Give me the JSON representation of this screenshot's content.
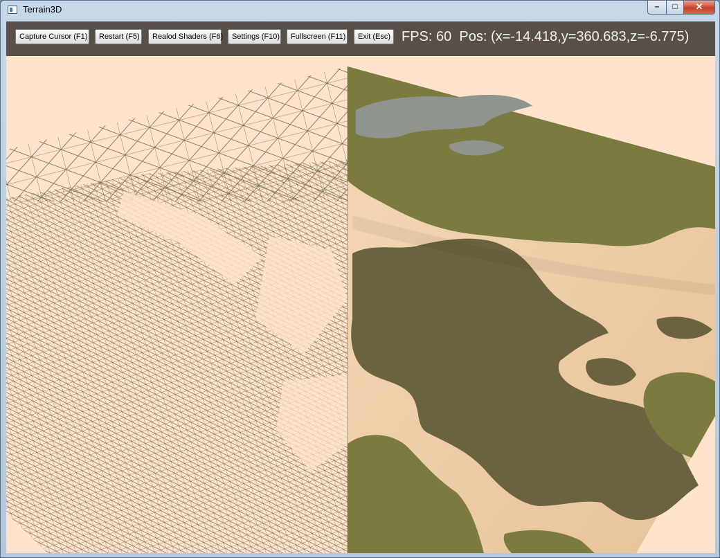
{
  "window": {
    "title": "Terrain3D",
    "controls": {
      "minimize": "–",
      "maximize": "□",
      "close": "✕"
    }
  },
  "toolbar": {
    "buttons": [
      "Capture Cursor (F1)",
      "Restart (F5)",
      "Realod Shaders (F6)",
      "Settings (F10)",
      "Fullscreen (F11)",
      "Exit (Esc)"
    ],
    "fps": "FPS: 60",
    "pos": "Pos: (x=-14.418,y=360.683,z=-6.775)"
  },
  "colors": {
    "background": "#ffe3cc",
    "toolbar": "#575048",
    "wire": "#6f6a4e",
    "grass": "#7b7a3f",
    "dirt": "#6b6340",
    "rock": "#8f948e",
    "sand": "#f0d0a8"
  },
  "icons": [
    "app-window-icon",
    "minimize-icon",
    "maximize-icon",
    "close-icon"
  ]
}
